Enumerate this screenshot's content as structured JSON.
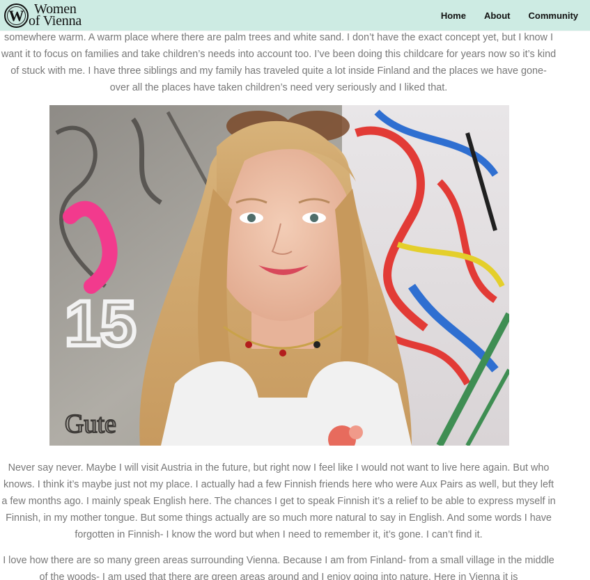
{
  "brand": {
    "logo_letter": "W",
    "name_line1": "Women",
    "name_line2": "of Vienna"
  },
  "nav": {
    "items": [
      {
        "label": "Home"
      },
      {
        "label": "About"
      },
      {
        "label": "Community"
      }
    ]
  },
  "article": {
    "paragraph_1": "somewhere warm. A warm place where there are palm trees and white sand. I don’t have the exact concept yet, but I know I want it to focus on families and take children’s needs into account too. I’ve been doing this childcare for years now so it’s kind of stuck with me. I have three siblings and my family has traveled quite a lot inside Finland and the places we have gone- over all the places have taken children’s need very seriously and I liked that.",
    "paragraph_2": "Never say never. Maybe I will visit Austria in the future, but right now I feel like I would not want to live here again. But who knows. I think it’s maybe just not my place. I actually had a few Finnish friends here who were Aux Pairs as well, but they left a few months ago. I mainly speak English here. The chances I get to speak Finnish it’s a relief to be able to express myself in Finnish, in my mother tongue. But some things actually are so much more natural to say in English. And some words I have forgotten in Finnish- I know the word but when I need to remember it, it’s gone. I can’t find it.",
    "paragraph_3": "I love how there are so many green areas surrounding Vienna. Because I am from Finland- from a small village in the middle of the woods- I am used that there are green areas around and I enjoy going into nature. Here in Vienna it is",
    "photo": {
      "graffiti_text": "15",
      "graffiti_tag": "Gute"
    }
  },
  "colors": {
    "header_bg": "#cdebe3",
    "body_text": "#777777",
    "nav_text": "#111111"
  }
}
